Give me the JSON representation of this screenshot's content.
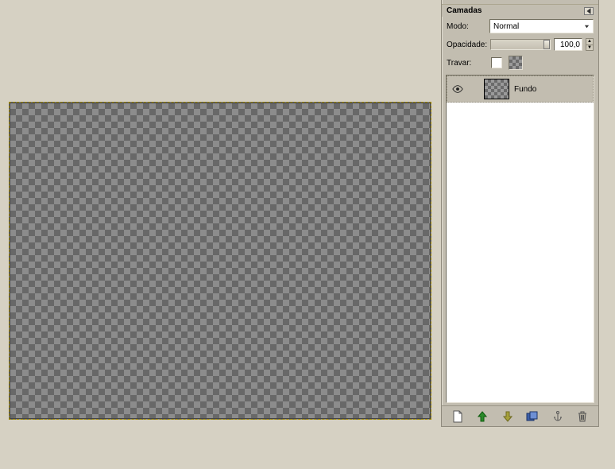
{
  "panel": {
    "title": "Camadas",
    "mode_label": "Modo:",
    "mode_value": "Normal",
    "opacity_label": "Opacidade:",
    "opacity_value": "100,0",
    "lock_label": "Travar:"
  },
  "layers": [
    {
      "name": "Fundo",
      "visible": true
    }
  ],
  "icons": {
    "new": "new-layer-icon",
    "raise": "raise-layer-icon",
    "lower": "lower-layer-icon",
    "duplicate": "duplicate-layer-icon",
    "anchor": "anchor-layer-icon",
    "delete": "delete-layer-icon"
  },
  "colors": {
    "accent": "#c2bdb0",
    "bg": "#d6d1c3"
  }
}
